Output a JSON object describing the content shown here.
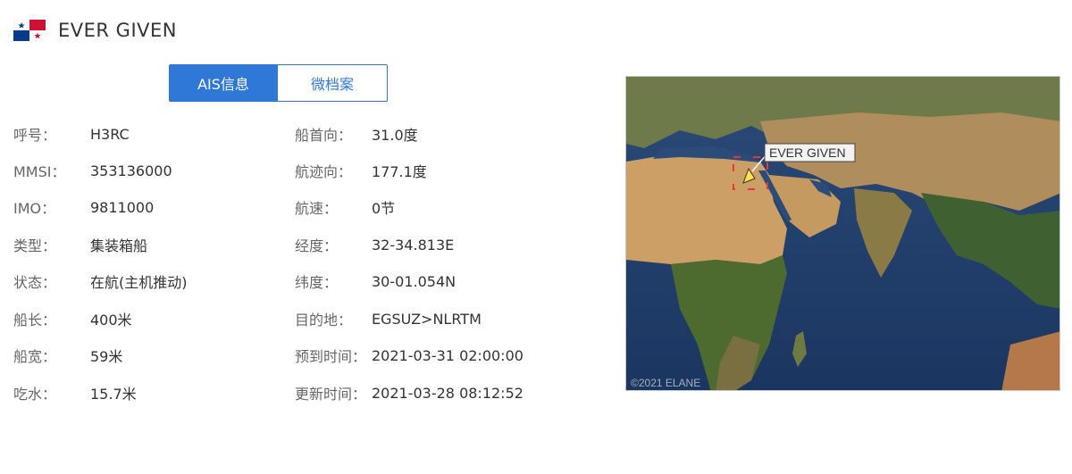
{
  "header": {
    "flag_icon": "panama-flag-icon",
    "ship_name": "EVER GIVEN"
  },
  "tabs": [
    {
      "label": "AIS信息",
      "active": true
    },
    {
      "label": "微档案",
      "active": false
    }
  ],
  "info_left": [
    {
      "label": "呼号：",
      "value": "H3RC"
    },
    {
      "label": "MMSI：",
      "value": "353136000"
    },
    {
      "label": "IMO：",
      "value": "9811000"
    },
    {
      "label": "类型：",
      "value": "集装箱船"
    },
    {
      "label": "状态：",
      "value": "在航(主机推动)"
    },
    {
      "label": "船长：",
      "value": "400米"
    },
    {
      "label": "船宽：",
      "value": "59米"
    },
    {
      "label": "吃水：",
      "value": "15.7米"
    }
  ],
  "info_right": [
    {
      "label": "船首向：",
      "value": "31.0度"
    },
    {
      "label": "航迹向：",
      "value": "177.1度"
    },
    {
      "label": "航速：",
      "value": "0节"
    },
    {
      "label": "经度：",
      "value": "32-34.813E"
    },
    {
      "label": "纬度：",
      "value": "30-01.054N"
    },
    {
      "label": "目的地：",
      "value": "EGSUZ>NLRTM"
    },
    {
      "label": "预到时间：",
      "value": "2021-03-31 02:00:00"
    },
    {
      "label": "更新时间：",
      "value": "2021-03-28 08:12:52"
    }
  ],
  "map": {
    "ship_label": "EVER GIVEN",
    "copyright": "©2021 ELANE",
    "colors": {
      "ocean": "#1f3d6b",
      "desert": "#c69a62",
      "vegetation": "#4d6b2e"
    }
  },
  "colors": {
    "accent": "#2f78d8",
    "label": "#666666",
    "value": "#333333"
  }
}
